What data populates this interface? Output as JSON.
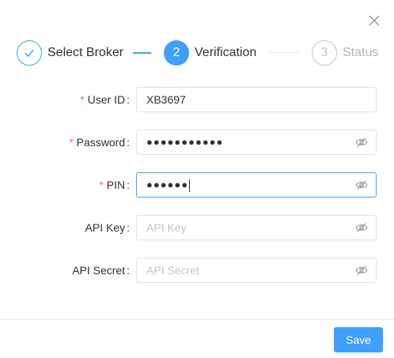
{
  "dialog": {
    "close_icon": "close-icon"
  },
  "steps": [
    {
      "label": "Select Broker",
      "status": "done",
      "icon": "check-icon"
    },
    {
      "label": "Verification",
      "status": "active",
      "number": "2"
    },
    {
      "label": "Status",
      "status": "wait",
      "number": "3"
    }
  ],
  "form": {
    "user_id": {
      "label": "User ID",
      "required": true,
      "value": "XB3697",
      "placeholder": ""
    },
    "password": {
      "label": "Password",
      "required": true,
      "value": "●●●●●●●●●●●",
      "icon": "eye-off-icon"
    },
    "pin": {
      "label": "PIN",
      "required": true,
      "value": "●●●●●●",
      "icon": "eye-off-icon",
      "focused": true
    },
    "api_key": {
      "label": "API Key",
      "required": false,
      "value": "",
      "placeholder": "API Key",
      "icon": "eye-off-icon"
    },
    "api_secret": {
      "label": "API Secret",
      "required": false,
      "value": "",
      "placeholder": "API Secret",
      "icon": "eye-off-icon"
    }
  },
  "footer": {
    "save_label": "Save"
  },
  "colors": {
    "primary": "#409eff",
    "required": "#f56c6c",
    "muted": "#c0c4cc"
  }
}
